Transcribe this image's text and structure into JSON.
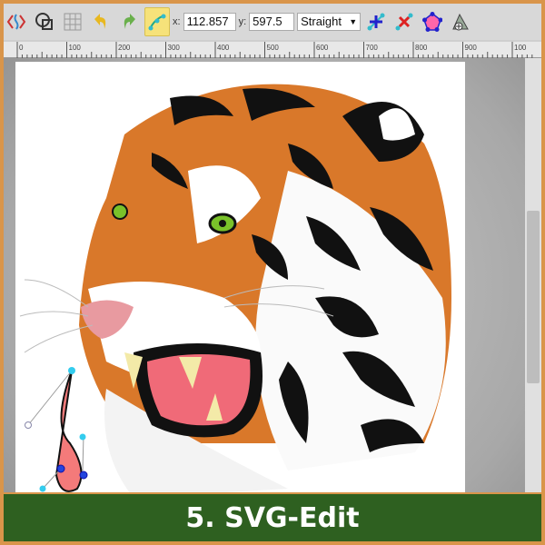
{
  "toolbar": {
    "icons": [
      "svg-source-icon",
      "clone-icon",
      "grid-icon",
      "undo-icon",
      "redo-icon",
      "node-edit-icon"
    ],
    "x_label": "x:",
    "x_value": "112.857",
    "y_label": "y:",
    "y_value": "597.5",
    "segment_type": "Straight",
    "node_icons": [
      "add-node-icon",
      "delete-node-icon",
      "close-path-icon",
      "add-subpath-icon"
    ]
  },
  "ruler": {
    "ticks": [
      "0",
      "100",
      "200",
      "300",
      "400",
      "500",
      "600",
      "700",
      "800",
      "900",
      "100"
    ]
  },
  "banner": {
    "title": "5. SVG-Edit"
  },
  "colors": {
    "border": "#d9954a",
    "banner": "#2e6020",
    "active_tool": "#f6e27a",
    "node": "#33ccee"
  }
}
